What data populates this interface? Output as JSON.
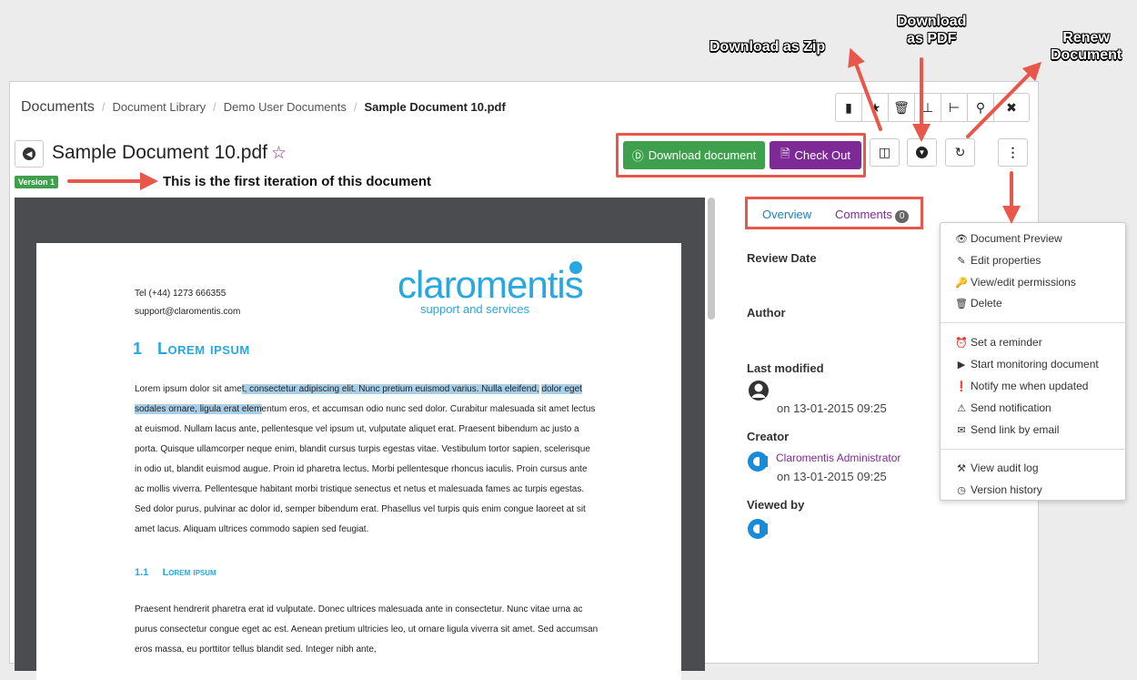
{
  "breadcrumb": {
    "root": "Documents",
    "items": [
      "Document Library",
      "Demo User Documents"
    ],
    "current": "Sample Document 10.pdf"
  },
  "toolbar_icons": [
    "file-icon",
    "star-icon",
    "trash-icon",
    "sitemap-icon",
    "branch-icon",
    "search-icon",
    "tools-icon"
  ],
  "document": {
    "title": "Sample Document 10.pdf",
    "version_badge": "Version 1",
    "iteration_note": "This is the first iteration of this document"
  },
  "actions": {
    "download": "Download document",
    "checkout": "Check Out"
  },
  "annotations": {
    "zip": "Download as Zip",
    "pdf_line1": "Download",
    "pdf_line2": "as PDF",
    "renew_line1": "Renew",
    "renew_line2": "Document"
  },
  "preview": {
    "tel": "Tel (+44) 1273 666355",
    "email": "support@claromentis.com",
    "logo": "claromentis",
    "logo_sub": "support and services",
    "heading1_num": "1",
    "heading1": "Lorem ipsum",
    "para1_pre": "Lorem ipsum dolor sit ame",
    "para1_hl1": "t, consectetur adipiscing elit. Nunc pretium euismod varius. Nulla eleifend,",
    "para1_hl2": "dolor eget sodales ornare, ligula erat elem",
    "para1_rest": "entum eros, et accumsan odio nunc sed dolor. Curabitur malesuada sit amet lectus at euismod. Nullam lacus ante, pellentesque vel ipsum ut, vulputate aliquet erat. Praesent bibendum ac justo a porta. Quisque ullamcorper neque enim, blandit cursus turpis egestas vitae. Vestibulum tortor sapien, scelerisque in odio ut, blandit euismod augue. Proin id pharetra lectus. Morbi pellentesque rhoncus iaculis. Proin cursus ante ac mollis viverra. Pellentesque habitant morbi tristique senectus et netus et malesuada fames ac turpis egestas. Sed dolor purus, pulvinar ac dolor id, semper bibendum erat. Phasellus vel turpis quis enim congue laoreet at sit amet lacus. Aliquam ultrices commodo sapien sed feugiat.",
    "heading2_num": "1.1",
    "heading2": "Lorem ipsum",
    "para2": "Praesent hendrerit pharetra erat id vulputate. Donec ultrices malesuada ante in consectetur. Nunc vitae urna ac purus consectetur congue eget ac est. Aenean pretium ultricies leo, ut ornare ligula viverra sit amet. Sed accumsan eros massa, eu porttitor tellus blandit sed. Integer nibh ante,"
  },
  "side": {
    "tab_overview": "Overview",
    "tab_comments": "Comments",
    "comments_count": "0",
    "review_date_label": "Review Date",
    "author_label": "Author",
    "last_modified_label": "Last modified",
    "last_modified_value": "on 13-01-2015 09:25",
    "creator_label": "Creator",
    "creator_name": "Claromentis Administrator",
    "creator_date": "on 13-01-2015 09:25",
    "viewed_by_label": "Viewed by"
  },
  "menu": {
    "items_a": [
      "Document Preview",
      "Edit properties",
      "View/edit permissions",
      "Delete"
    ],
    "items_b": [
      "Set a reminder",
      "Start monitoring document",
      "Notify me when updated",
      "Send notification",
      "Send link by email"
    ],
    "items_c": [
      "View audit log",
      "Version history"
    ]
  },
  "colors": {
    "accent_green": "#3ea04d",
    "accent_purple": "#7d2a96",
    "annotation_red": "#e8574a",
    "brand_blue": "#29a7e1"
  }
}
